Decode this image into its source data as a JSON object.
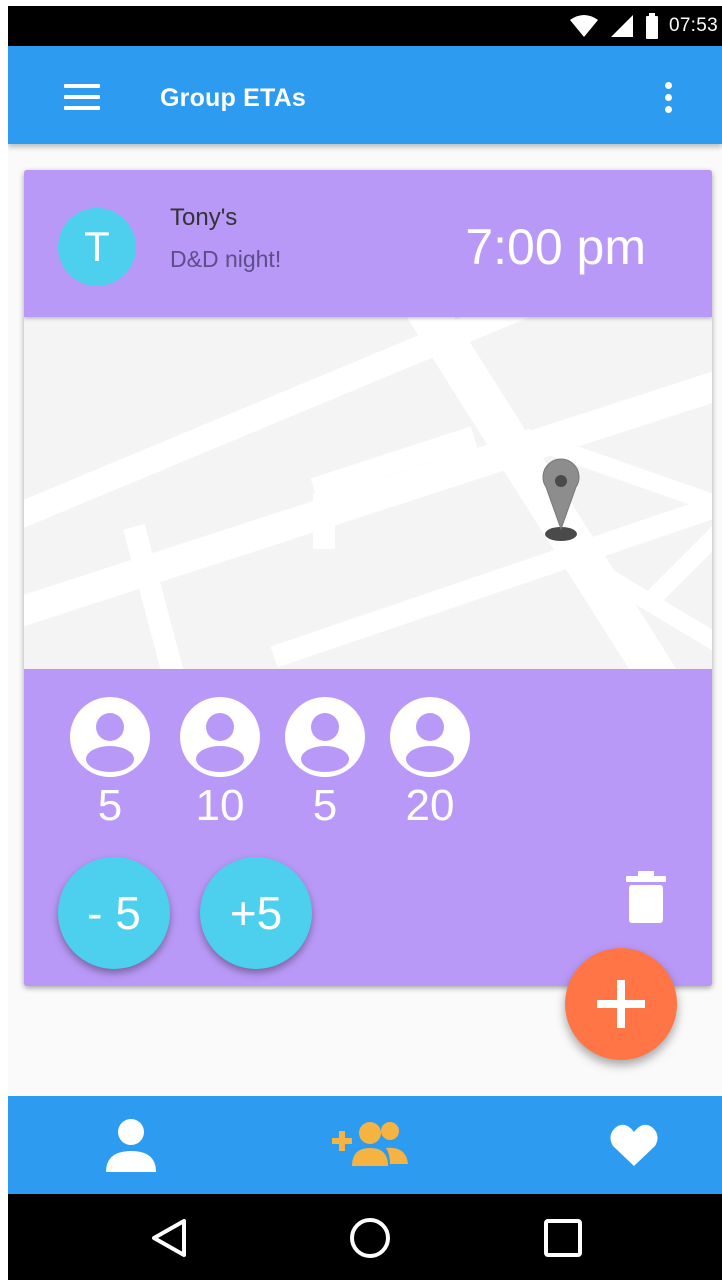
{
  "status_bar": {
    "time": "07:53",
    "icons": [
      "wifi-icon",
      "signal-icon",
      "battery-icon"
    ]
  },
  "app_bar": {
    "title": "Group ETAs",
    "menu_icon": "hamburger-menu-icon",
    "overflow_icon": "more-vert-icon"
  },
  "event": {
    "avatar_letter": "T",
    "host": "Tony's",
    "name": "D&D night!",
    "time": "7:00 pm",
    "map_icon": "location-pin-icon"
  },
  "members": [
    {
      "eta": "5",
      "icon": "person-icon"
    },
    {
      "eta": "10",
      "icon": "person-icon"
    },
    {
      "eta": "5",
      "icon": "person-icon"
    },
    {
      "eta": "20",
      "icon": "person-icon"
    }
  ],
  "actions": {
    "minus_label": "- 5",
    "plus_label": "+5",
    "delete_icon": "trash-icon"
  },
  "fab": {
    "icon": "plus-icon"
  },
  "bottom_nav": [
    {
      "name": "profile",
      "icon": "person-icon"
    },
    {
      "name": "groups",
      "icon": "add-group-icon",
      "active": true
    },
    {
      "name": "favorites",
      "icon": "heart-icon"
    }
  ],
  "system_nav": [
    "back-icon",
    "home-icon",
    "recents-icon"
  ],
  "colors": {
    "app_bar": "#2d9cf0",
    "card": "#b999f7",
    "accent_cyan": "#4dd0ee",
    "fab": "#ff7545",
    "active_nav": "#f5b342"
  }
}
